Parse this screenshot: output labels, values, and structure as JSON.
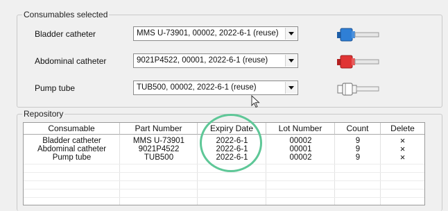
{
  "consumables_selected": {
    "title": "Consumables selected",
    "rows": [
      {
        "label": "Bladder catheter",
        "value": "MMS U-73901, 00002, 2022-6-1 (reuse)",
        "connector_color": "#2f7fd6",
        "connector_icon": "bladder-catheter-connector-icon"
      },
      {
        "label": "Abdominal catheter",
        "value": "9021P4522, 00001, 2022-6-1 (reuse)",
        "connector_color": "#e03434",
        "connector_icon": "abdominal-catheter-connector-icon"
      },
      {
        "label": "Pump tube",
        "value": "TUB500, 00002, 2022-6-1 (reuse)",
        "connector_color": "#ffffff",
        "connector_icon": "pump-tube-connector-icon"
      }
    ]
  },
  "repository": {
    "title": "Repository",
    "columns": [
      "Consumable",
      "Part Number",
      "Expiry Date",
      "Lot Number",
      "Count",
      "Delete"
    ],
    "rows": [
      {
        "consumable": "Bladder catheter",
        "part_number": "MMS U-73901",
        "expiry_date": "2022-6-1",
        "lot_number": "00002",
        "count": "9",
        "delete": "×"
      },
      {
        "consumable": "Abdominal catheter",
        "part_number": "9021P4522",
        "expiry_date": "2022-6-1",
        "lot_number": "00001",
        "count": "9",
        "delete": "×"
      },
      {
        "consumable": "Pump tube",
        "part_number": "TUB500",
        "expiry_date": "2022-6-1",
        "lot_number": "00002",
        "count": "9",
        "delete": "×"
      }
    ]
  },
  "annotation": {
    "highlight_color": "#5ec797",
    "highlight_target": "Expiry Date"
  }
}
